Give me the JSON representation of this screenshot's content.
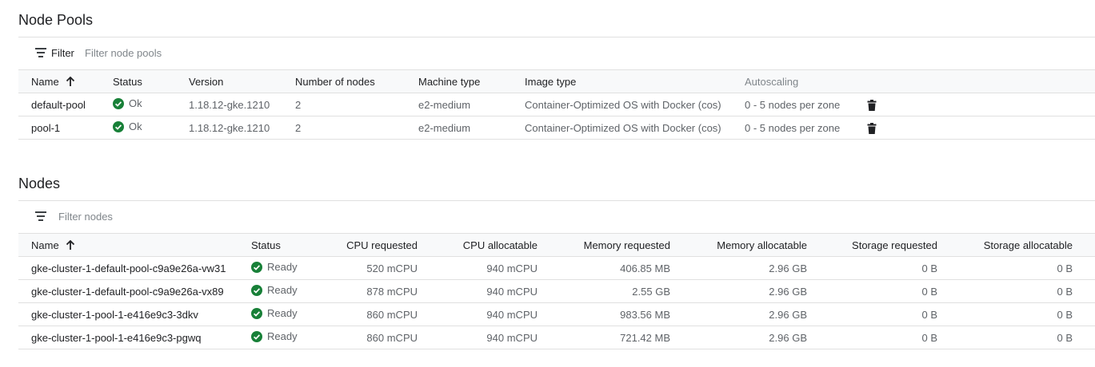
{
  "node_pools": {
    "title": "Node Pools",
    "filter": {
      "label": "Filter",
      "placeholder": "Filter node pools"
    },
    "columns": {
      "name": "Name",
      "status": "Status",
      "version": "Version",
      "num_nodes": "Number of nodes",
      "machine_type": "Machine type",
      "image_type": "Image type",
      "autoscaling": "Autoscaling"
    },
    "rows": [
      {
        "name": "default-pool",
        "status": "Ok",
        "version": "1.18.12-gke.1210",
        "num_nodes": "2",
        "machine_type": "e2-medium",
        "image_type": "Container-Optimized OS with Docker (cos)",
        "autoscaling": "0 - 5 nodes per zone",
        "action_icon": "trash-icon"
      },
      {
        "name": "pool-1",
        "status": "Ok",
        "version": "1.18.12-gke.1210",
        "num_nodes": "2",
        "machine_type": "e2-medium",
        "image_type": "Container-Optimized OS with Docker (cos)",
        "autoscaling": "0 - 5 nodes per zone",
        "action_icon": "trash-icon"
      }
    ]
  },
  "nodes": {
    "title": "Nodes",
    "filter": {
      "placeholder": "Filter nodes"
    },
    "columns": {
      "name": "Name",
      "status": "Status",
      "cpu_requested": "CPU requested",
      "cpu_allocatable": "CPU allocatable",
      "memory_requested": "Memory requested",
      "memory_allocatable": "Memory allocatable",
      "storage_requested": "Storage requested",
      "storage_allocatable": "Storage allocatable"
    },
    "rows": [
      {
        "name": "gke-cluster-1-default-pool-c9a9e26a-vw31",
        "status": "Ready",
        "cpu_requested": "520 mCPU",
        "cpu_allocatable": "940 mCPU",
        "memory_requested": "406.85 MB",
        "memory_allocatable": "2.96 GB",
        "storage_requested": "0 B",
        "storage_allocatable": "0 B"
      },
      {
        "name": "gke-cluster-1-default-pool-c9a9e26a-vx89",
        "status": "Ready",
        "cpu_requested": "878 mCPU",
        "cpu_allocatable": "940 mCPU",
        "memory_requested": "2.55 GB",
        "memory_allocatable": "2.96 GB",
        "storage_requested": "0 B",
        "storage_allocatable": "0 B"
      },
      {
        "name": "gke-cluster-1-pool-1-e416e9c3-3dkv",
        "status": "Ready",
        "cpu_requested": "860 mCPU",
        "cpu_allocatable": "940 mCPU",
        "memory_requested": "983.56 MB",
        "memory_allocatable": "2.96 GB",
        "storage_requested": "0 B",
        "storage_allocatable": "0 B"
      },
      {
        "name": "gke-cluster-1-pool-1-e416e9c3-pgwq",
        "status": "Ready",
        "cpu_requested": "860 mCPU",
        "cpu_allocatable": "940 mCPU",
        "memory_requested": "721.42 MB",
        "memory_allocatable": "2.96 GB",
        "storage_requested": "0 B",
        "storage_allocatable": "0 B"
      }
    ]
  },
  "colors": {
    "status_ok": "#188038",
    "text_primary": "#202124",
    "text_secondary": "#5f6368",
    "border": "#e0e0e0"
  },
  "icons": {
    "sort": "arrow-up-icon",
    "filter": "filter-icon",
    "status": "check-circle-icon",
    "delete": "trash-icon"
  }
}
